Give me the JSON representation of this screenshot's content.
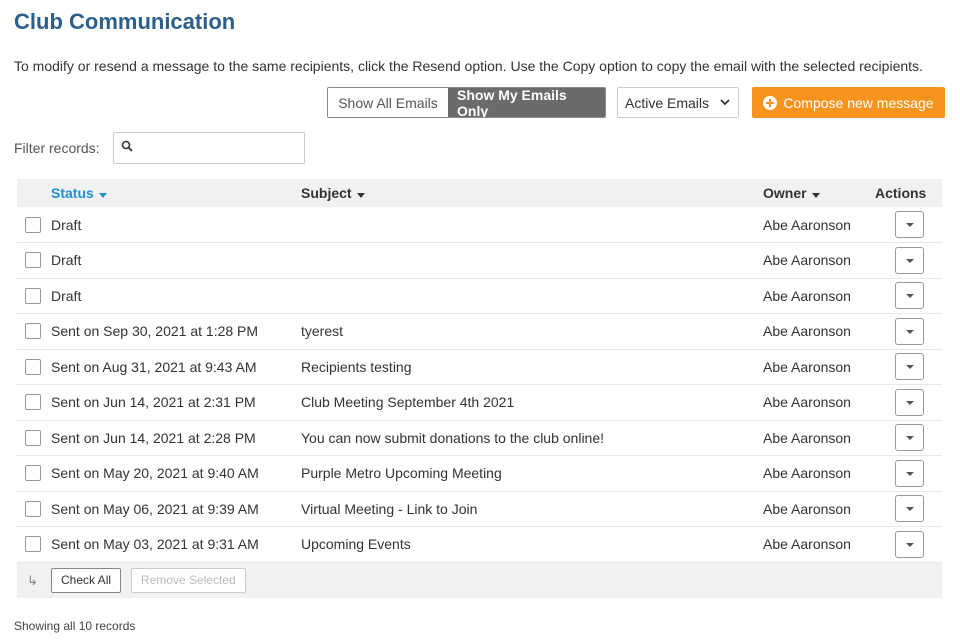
{
  "page": {
    "title": "Club Communication",
    "intro": "To modify or resend a message to the same recipients, click the Resend option. Use the Copy option to copy the email with the selected recipients."
  },
  "toolbar": {
    "show_all": "Show All Emails",
    "show_mine": "Show My Emails Only",
    "email_filter": "Active Emails",
    "compose": "Compose new message",
    "compose_color": "#f7941d"
  },
  "filter": {
    "label": "Filter records:",
    "value": "",
    "icon": "search-icon"
  },
  "table": {
    "headers": {
      "status": "Status",
      "subject": "Subject",
      "owner": "Owner",
      "actions": "Actions"
    },
    "rows": [
      {
        "status": "Draft",
        "subject": "",
        "owner": "Abe Aaronson"
      },
      {
        "status": "Draft",
        "subject": "",
        "owner": "Abe Aaronson"
      },
      {
        "status": "Draft",
        "subject": "",
        "owner": "Abe Aaronson"
      },
      {
        "status": "Sent on Sep 30, 2021 at 1:28 PM",
        "subject": "tyerest",
        "owner": "Abe Aaronson"
      },
      {
        "status": "Sent on Aug 31, 2021 at 9:43 AM",
        "subject": "Recipients testing",
        "owner": "Abe Aaronson"
      },
      {
        "status": "Sent on Jun 14, 2021 at 2:31 PM",
        "subject": "Club Meeting September 4th 2021",
        "owner": "Abe Aaronson"
      },
      {
        "status": "Sent on Jun 14, 2021 at 2:28 PM",
        "subject": "You can now submit donations to the club online!",
        "owner": "Abe Aaronson"
      },
      {
        "status": "Sent on May 20, 2021 at 9:40 AM",
        "subject": "Purple Metro Upcoming Meeting",
        "owner": "Abe Aaronson"
      },
      {
        "status": "Sent on May 06, 2021 at 9:39 AM",
        "subject": "Virtual Meeting - Link to Join",
        "owner": "Abe Aaronson"
      },
      {
        "status": "Sent on May 03, 2021 at 9:31 AM",
        "subject": "Upcoming Events",
        "owner": "Abe Aaronson"
      }
    ],
    "footer": {
      "check_all": "Check All",
      "remove_selected": "Remove Selected"
    }
  },
  "records_text": "Showing all 10 records"
}
